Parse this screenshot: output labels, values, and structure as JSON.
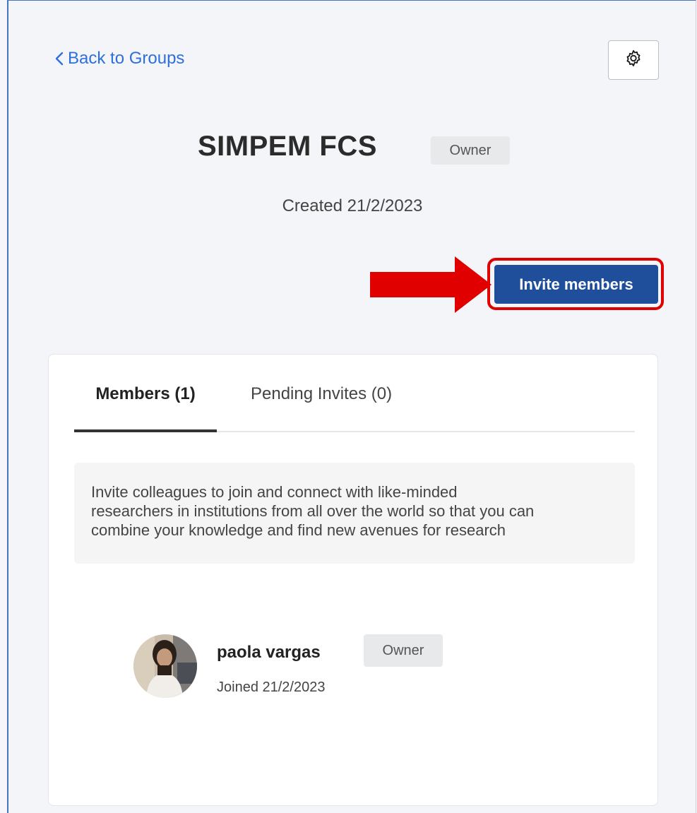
{
  "nav": {
    "back_label": "Back to Groups"
  },
  "group": {
    "title": "SIMPEM FCS",
    "role_badge": "Owner",
    "created": "Created 21/2/2023"
  },
  "actions": {
    "invite_label": "Invite members"
  },
  "tabs": [
    {
      "label": "Members (1)",
      "active": true
    },
    {
      "label": "Pending Invites (0)",
      "active": false
    }
  ],
  "info": {
    "line1": "Invite colleagues to join and connect with like-minded",
    "line2": "researchers in institutions from all over the world so that you can",
    "line3": "combine your knowledge and find new avenues for research"
  },
  "members": [
    {
      "name": "paola vargas",
      "role": "Owner",
      "joined": "Joined 21/2/2023"
    }
  ],
  "icons": {
    "back": "chevron-left-icon",
    "settings": "gear-icon",
    "annotation": "red-arrow-icon"
  },
  "colors": {
    "link": "#2f6fdc",
    "primary_button": "#1f4e9b",
    "highlight": "#e00000"
  }
}
